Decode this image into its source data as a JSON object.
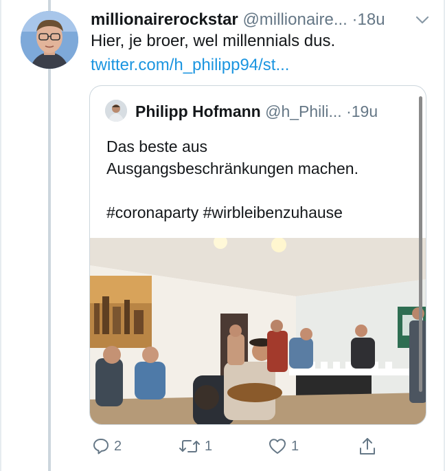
{
  "tweet": {
    "display_name": "millionairerockstar",
    "handle": "@millionaire...",
    "separator": "·",
    "time": "18u",
    "text": "Hier, je broer, wel millennials dus.",
    "link": "twitter.com/h_philipp94/st..."
  },
  "quoted_tweet": {
    "display_name": "Philipp Hofmann",
    "handle": "@h_Phili...",
    "separator": "·",
    "time": "19u",
    "text_lines": [
      "Das beste aus",
      "Ausgangsbeschränkungen machen.",
      "",
      "#coronaparty #wirbleibenzuhause"
    ]
  },
  "actions": {
    "replies": "2",
    "retweets": "1",
    "likes": "1"
  },
  "icons": {
    "menu": "chevron-down-icon",
    "reply": "reply-icon",
    "retweet": "retweet-icon",
    "like": "heart-icon",
    "share": "share-icon"
  },
  "colors": {
    "link": "#1b95e0",
    "secondary_text": "#657786",
    "thread_line": "#ccd6dd"
  }
}
